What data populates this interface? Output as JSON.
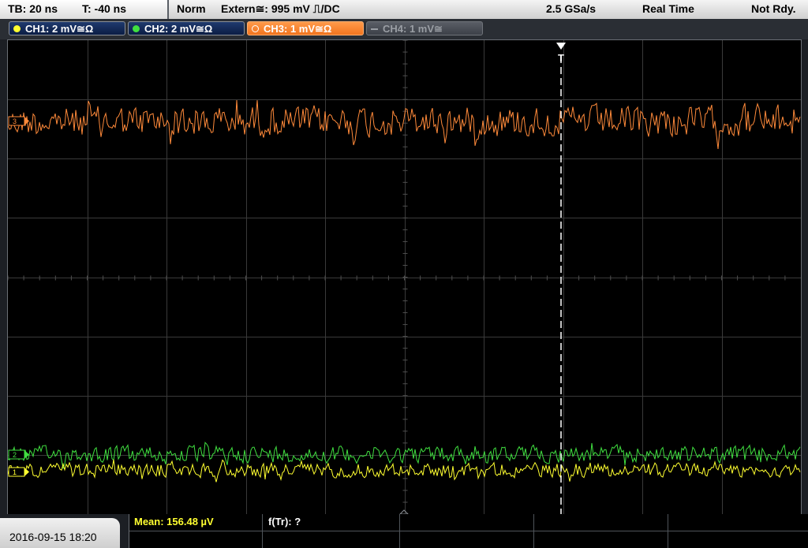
{
  "status": {
    "timebase": "TB: 20 ns",
    "trigger_pos": "T: -40 ns",
    "trigger_mode": "Norm",
    "trigger_source": "Extern≅: 995 mV ⎍/DC",
    "sample_rate": "2.5 GSa/s",
    "acq_mode": "Real Time",
    "state": "Not Rdy."
  },
  "channels": [
    {
      "label": "CH1: 2 mV≅Ω",
      "color": "#ffff30"
    },
    {
      "label": "CH2: 2 mV≅Ω",
      "color": "#40e040"
    },
    {
      "label": "CH3: 1 mV≅Ω",
      "color": "#ff8a3a"
    },
    {
      "label": "CH4: 1 mV≅",
      "color": "#8a8e94"
    }
  ],
  "markers": {
    "ch1": "1",
    "ch2": "2",
    "ch3": "3",
    "trigger": "T"
  },
  "datetime": "2016-09-15 18:20",
  "measurements": {
    "mean": "Mean: 156.48 µV",
    "ftr": "f(Tr): ?"
  }
}
